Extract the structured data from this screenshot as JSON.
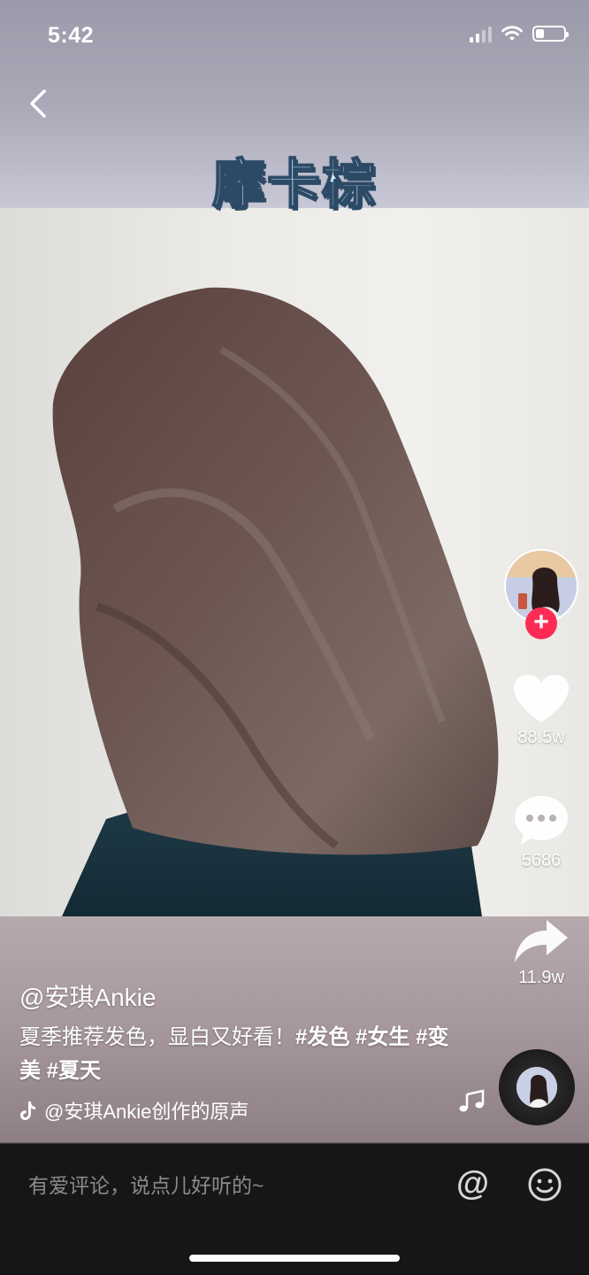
{
  "status_bar": {
    "time": "5:42"
  },
  "video": {
    "overlay_title": "摩卡棕"
  },
  "creator": {
    "follow_symbol": "+"
  },
  "actions": {
    "likes": "88.5w",
    "comments": "5686",
    "shares": "11.9w"
  },
  "post": {
    "author": "@安琪Ankie",
    "description_text": "夏季推荐发色，显白又好看！",
    "hashtags": [
      "#发色",
      "#女生",
      "#变美",
      "#夏天"
    ],
    "music": "@安琪Ankie创作的原声"
  },
  "comment_bar": {
    "placeholder": "有爱评论，说点儿好听的~",
    "at_symbol": "@"
  },
  "colors": {
    "follow_red": "#fe2c55",
    "bottom_bar": "#161616"
  }
}
